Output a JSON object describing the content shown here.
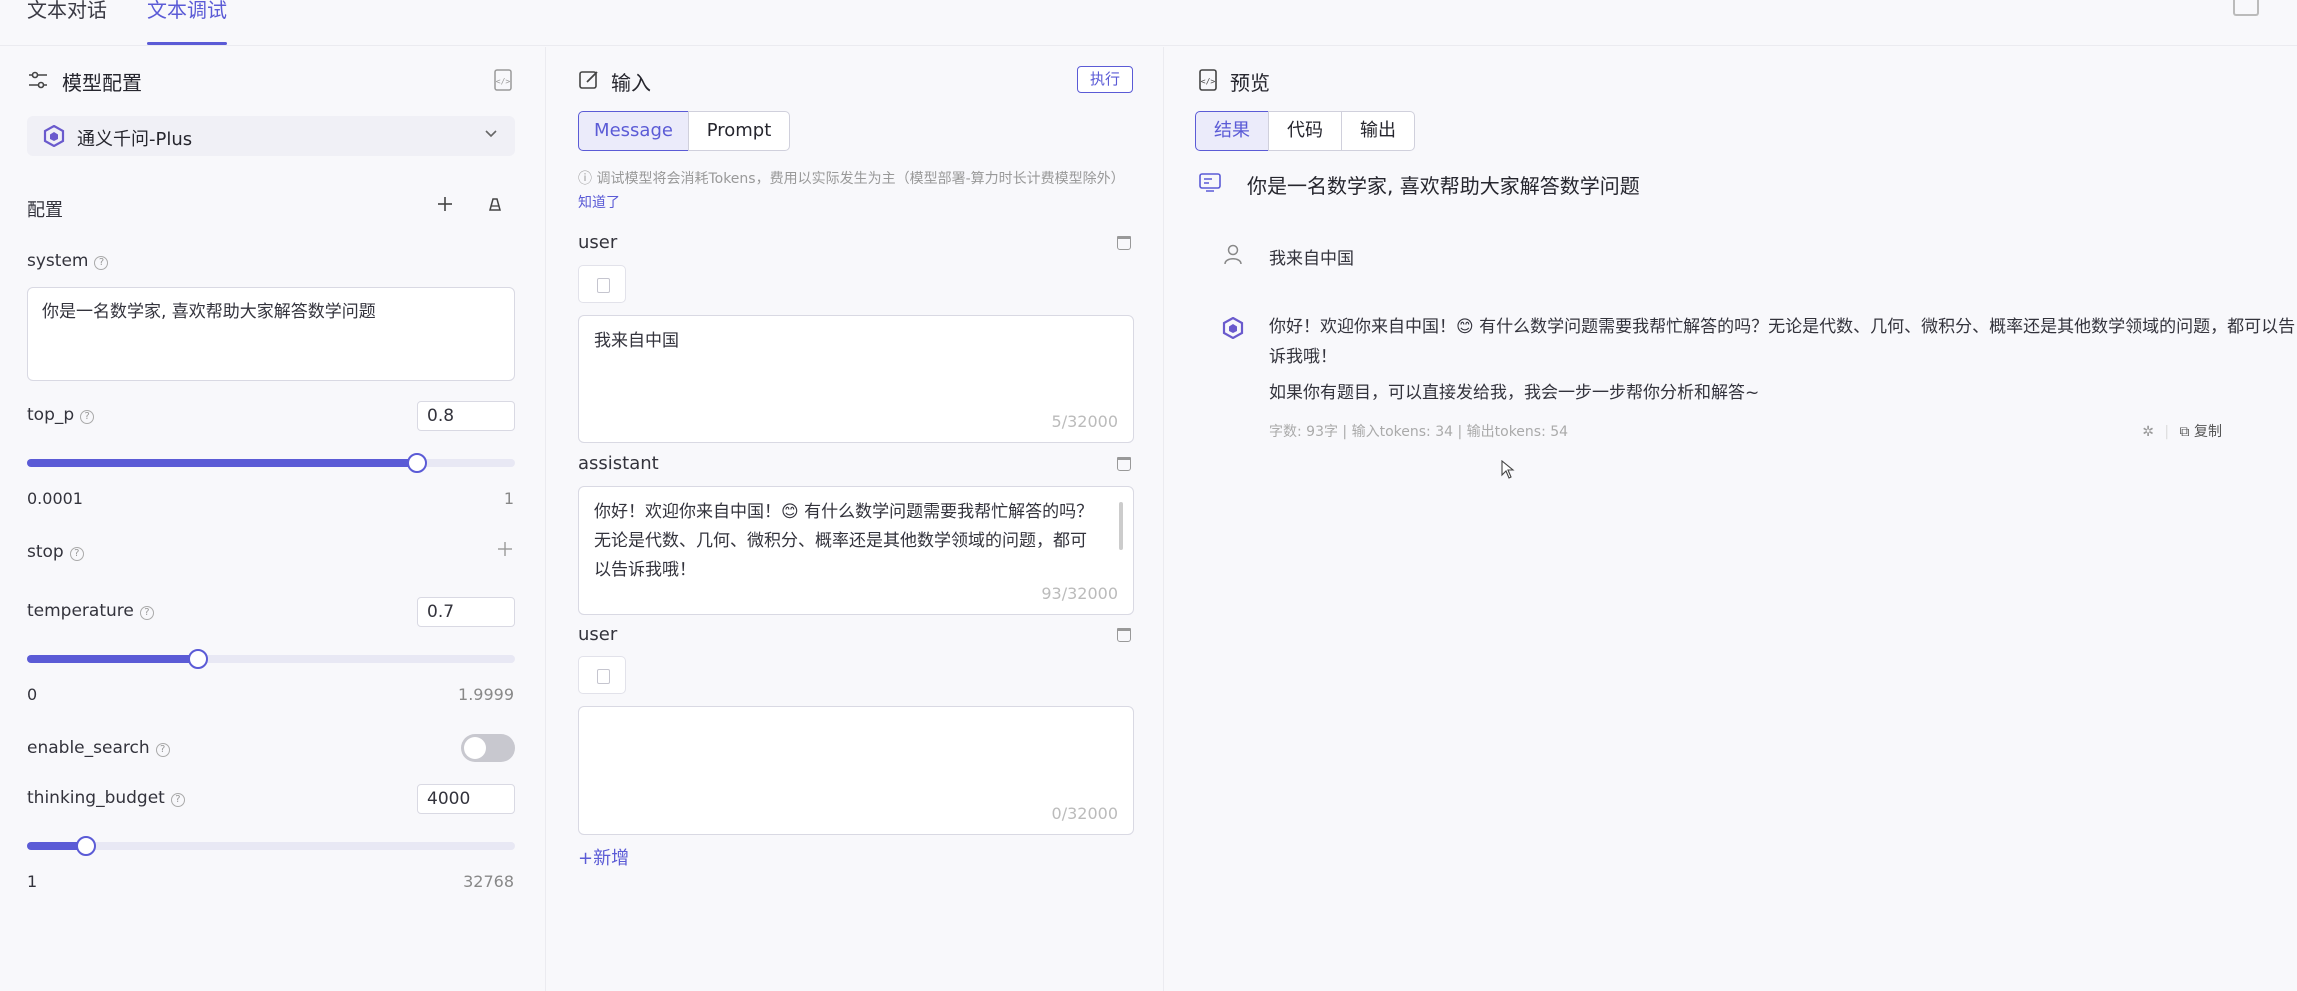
{
  "top_tabs": {
    "chat_tab": "文本对话",
    "debug_tab": "文本调试"
  },
  "config_panel": {
    "title": "模型配置",
    "model_name": "通义千问-Plus",
    "config_label": "配置",
    "system_label": "system",
    "system_value": "你是一名数学家, 喜欢帮助大家解答数学问题",
    "top_p": {
      "label": "top_p",
      "value": "0.8",
      "min": "0.0001",
      "max": "1",
      "fill": 0.8
    },
    "stop_label": "stop",
    "temperature": {
      "label": "temperature",
      "value": "0.7",
      "min": "0",
      "max": "1.9999",
      "fill": 0.35
    },
    "enable_search": {
      "label": "enable_search",
      "on": false
    },
    "thinking_budget": {
      "label": "thinking_budget",
      "value": "4000",
      "min": "1",
      "max": "32768",
      "fill": 0.12
    }
  },
  "input_panel": {
    "title": "输入",
    "run_label": "执行",
    "modes": [
      "Message",
      "Prompt"
    ],
    "active_mode": "Message",
    "tip_text": "调试模型将会消耗Tokens，费用以实际发生为主（模型部署-算力时长计费模型除外）",
    "tip_link": "知道了",
    "messages": [
      {
        "role": "user",
        "content": "我来自中国",
        "count": "5/32000"
      },
      {
        "role": "assistant",
        "content": "你好！欢迎你来自中国！😊 有什么数学问题需要我帮忙解答的吗？无论是代数、几何、微积分、概率还是其他数学领域的问题，都可以告诉我哦！",
        "count": "93/32000"
      },
      {
        "role": "user",
        "content": "",
        "count": "0/32000"
      }
    ],
    "add_label": "+新增"
  },
  "preview_panel": {
    "title": "预览",
    "tabs": [
      "结果",
      "代码",
      "输出"
    ],
    "active_tab": "结果",
    "system_prompt": "你是一名数学家, 喜欢帮助大家解答数学问题",
    "user_message": "我来自中国",
    "reply_line1": "你好！欢迎你来自中国！😊 有什么数学问题需要我帮忙解答的吗？无论是代数、几何、微积分、概率还是其他数学领域的问题，都可以告诉我哦！",
    "reply_line2": "如果你有题目，可以直接发给我，我会一步一步帮你分析和解答~",
    "meta": "字数: 93字 | 输入tokens: 34 | 输出tokens: 54",
    "copy_label": "复制"
  },
  "colors": {
    "accent": "#5b5bd6",
    "background": "#f8f8fb"
  }
}
